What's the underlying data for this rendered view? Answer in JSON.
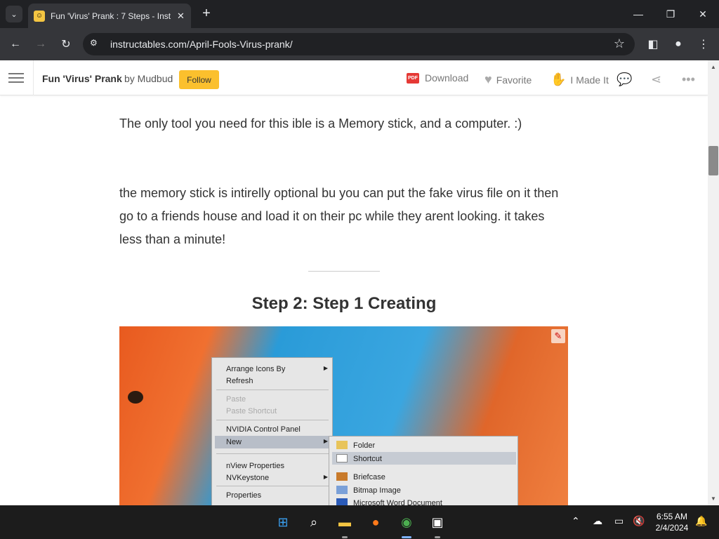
{
  "browser": {
    "tab_title": "Fun 'Virus' Prank : 7 Steps - Inst",
    "url": "instructables.com/April-Fools-Virus-prank/"
  },
  "site_header": {
    "project_title": "Fun 'Virus' Prank",
    "by_text": "by Mudbud",
    "follow_label": "Follow",
    "download_label": "Download",
    "pdf_badge": "PDF",
    "favorite_label": "Favorite",
    "made_it_label": "I Made It"
  },
  "article": {
    "para1": "The only tool you need for this ible is a Memory stick, and a computer. :)",
    "para2": "the memory stick is intirelly optional bu you can put the fake virus file on it then go to a friends house and load it on their pc while they arent looking. it takes less than a minute!",
    "step_title": "Step 2: Step 1 Creating"
  },
  "photo_menu": {
    "items": [
      "Arrange Icons By",
      "Refresh",
      "Paste",
      "Paste Shortcut",
      "NVIDIA Control Panel",
      "New",
      "nView Properties",
      "NVKeystone",
      "Properties"
    ],
    "submenu": [
      "Folder",
      "Shortcut",
      "Briefcase",
      "Bitmap Image",
      "Microsoft Word Document"
    ]
  },
  "taskbar": {
    "time": "6:55 AM",
    "date": "2/4/2024"
  },
  "colors": {
    "follow_button": "#fbc02d",
    "chrome_dark": "#202124",
    "taskbar": "#1c1c1c"
  }
}
